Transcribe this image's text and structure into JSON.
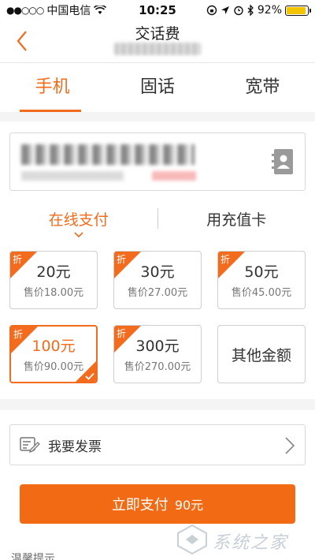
{
  "status_bar": {
    "carrier": "中国电信",
    "time": "10:25",
    "battery_percent": "92%",
    "battery_level": 0.92,
    "icons": [
      "signal-dots",
      "wifi-icon",
      "rotation-lock-icon",
      "location-arrow-icon",
      "alarm-icon",
      "bluetooth-icon",
      "battery-icon"
    ]
  },
  "nav": {
    "title": "交话费",
    "back_icon": "chevron-left-icon"
  },
  "tabs": [
    {
      "label": "手机",
      "active": true
    },
    {
      "label": "固话",
      "active": false
    },
    {
      "label": "宽带",
      "active": false
    }
  ],
  "phone_input": {
    "contacts_icon": "contact-book-icon"
  },
  "payment_modes": [
    {
      "label": "在线支付",
      "active": true
    },
    {
      "label": "用充值卡",
      "active": false
    }
  ],
  "amounts": [
    {
      "badge": "折",
      "face": "20元",
      "price": "售价18.00元",
      "selected": false
    },
    {
      "badge": "折",
      "face": "30元",
      "price": "售价27.00元",
      "selected": false
    },
    {
      "badge": "折",
      "face": "50元",
      "price": "售价45.00元",
      "selected": false
    },
    {
      "badge": "折",
      "face": "100元",
      "price": "售价90.00元",
      "selected": true
    },
    {
      "badge": "折",
      "face": "300元",
      "price": "售价270.00元",
      "selected": false
    },
    {
      "other": "其他金额"
    }
  ],
  "invoice": {
    "label": "我要发票",
    "icon": "invoice-edit-icon"
  },
  "pay_button": {
    "label": "立即支付",
    "amount": "90元"
  },
  "tip": {
    "label": "温馨提示"
  },
  "watermark": {
    "text": "系统之家"
  },
  "colors": {
    "accent": "#f36b1c",
    "button": "#f26a13",
    "battery": "#f5c400"
  }
}
